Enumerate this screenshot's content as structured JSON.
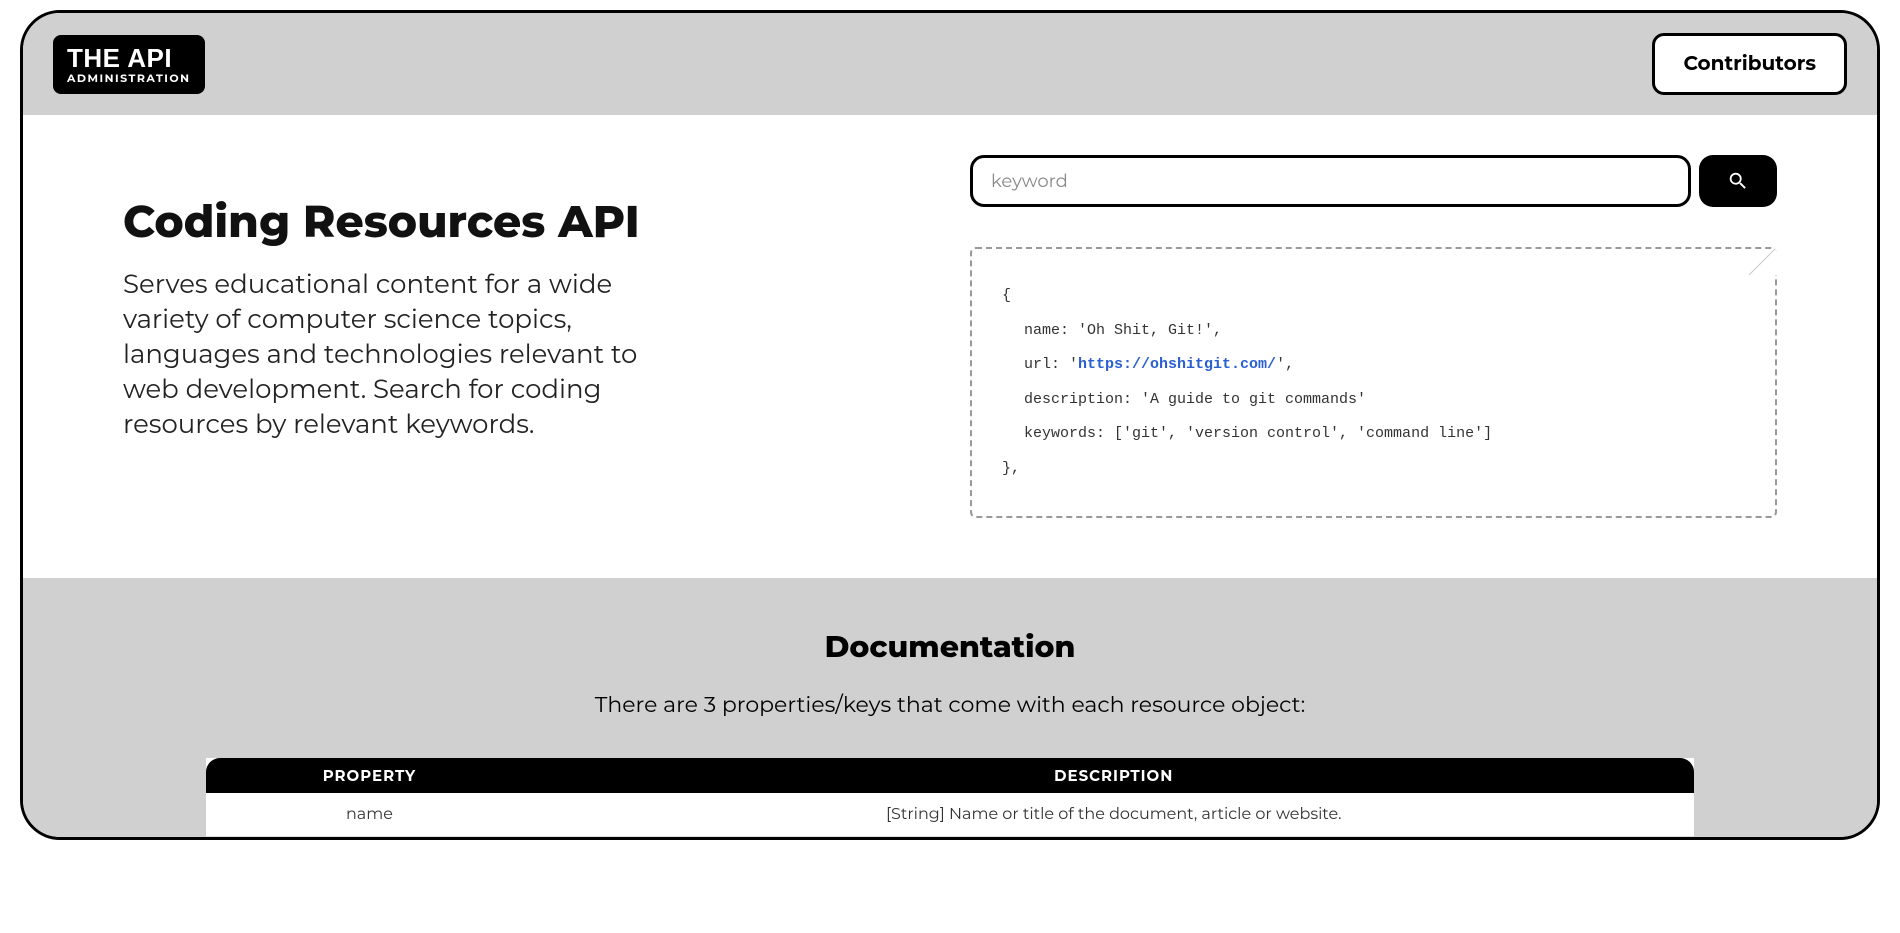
{
  "header": {
    "logo_main": "THE API",
    "logo_sub": "ADMINISTRATION",
    "contributors_label": "Contributors"
  },
  "hero": {
    "title": "Coding Resources API",
    "intro": "Serves educational content for a wide variety of computer science topics, languages and technologies relevant to web development. Search for coding resources by relevant keywords."
  },
  "search": {
    "placeholder": "keyword"
  },
  "sample": {
    "open": "{",
    "name_line": "name: 'Oh Shit, Git!',",
    "url_prefix": "url: '",
    "url_value": "https://ohshitgit.com/",
    "url_suffix": "',",
    "desc_line": "description: 'A guide to git commands'",
    "keywords_line": "keywords: ['git', 'version control', 'command line']",
    "close": "},"
  },
  "docs": {
    "title": "Documentation",
    "intro": "There are 3 properties/keys that come with each resource object:",
    "table": {
      "header_property": "PROPERTY",
      "header_description": "DESCRIPTION",
      "row1_property": "name",
      "row1_description": "[String] Name or title of the document, article or website."
    }
  }
}
